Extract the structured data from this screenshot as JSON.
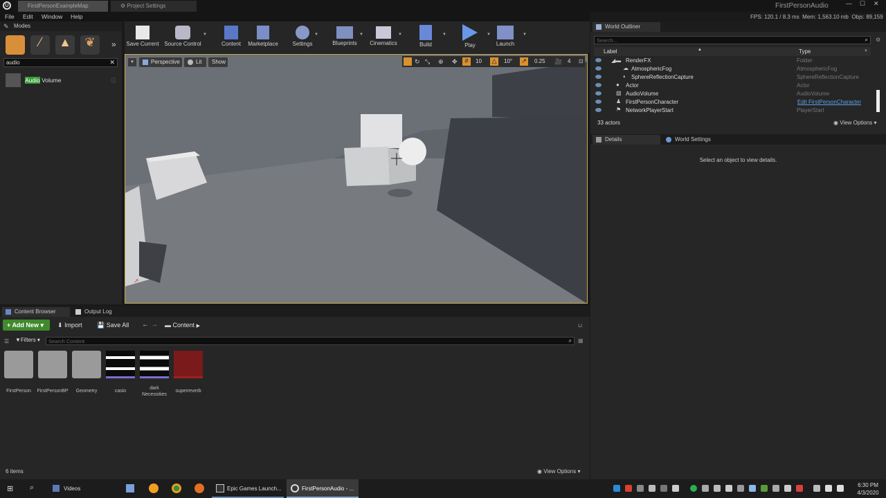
{
  "window": {
    "tabs": [
      "FirstPersonExampleMap",
      "Project Settings"
    ],
    "project_name": "FirstPersonAudio",
    "stats": {
      "fps": "FPS: 120.1",
      "ms": "/ 8.3 ms",
      "mem": "Mem: 1,563.10 mb",
      "objs": "Objs: 89,159"
    }
  },
  "menu": [
    "File",
    "Edit",
    "Window",
    "Help"
  ],
  "modes": {
    "title": "Modes",
    "search_value": "audio",
    "result_highlight": "Audio",
    "result_rest": " Volume"
  },
  "toolbar": [
    {
      "label": "Save Current",
      "icon": "save-icon"
    },
    {
      "label": "Source Control",
      "icon": "source-control-icon"
    },
    {
      "label": "Content",
      "icon": "content-icon"
    },
    {
      "label": "Marketplace",
      "icon": "marketplace-icon"
    },
    {
      "label": "Settings",
      "icon": "settings-icon"
    },
    {
      "label": "Blueprints",
      "icon": "blueprints-icon"
    },
    {
      "label": "Cinematics",
      "icon": "cinematics-icon"
    },
    {
      "label": "Build",
      "icon": "build-icon"
    },
    {
      "label": "Play",
      "icon": "play-icon"
    },
    {
      "label": "Launch",
      "icon": "launch-icon"
    }
  ],
  "viewport": {
    "perspective": "Perspective",
    "lit": "Lit",
    "show": "Show",
    "grid_snap": "10",
    "rot_snap": "10°",
    "scale_snap": "0.25",
    "cam_speed": "4"
  },
  "content_browser": {
    "tabs": [
      "Content Browser",
      "Output Log"
    ],
    "add_new": "Add New",
    "import": "Import",
    "save_all": "Save All",
    "path": "Content",
    "filters": "Filters",
    "search_placeholder": "Search Content",
    "assets": [
      "FirstPerson",
      "FirstPersonBP",
      "Geometry",
      "casio",
      "dark Necessities",
      "superreverb"
    ],
    "item_count": "6 items",
    "view_options": "View Options"
  },
  "outliner": {
    "title": "World Outliner",
    "search_placeholder": "Search...",
    "col_label": "Label",
    "col_type": "Type",
    "rows": [
      {
        "label": "RenderFX",
        "type": "Folder"
      },
      {
        "label": "AtmosphericFog",
        "type": "AtmosphericFog"
      },
      {
        "label": "SphereReflectionCapture",
        "type": "SphereReflectionCapture"
      },
      {
        "label": "Actor",
        "type": "Actor"
      },
      {
        "label": "AudioVolume",
        "type": "AudioVolume"
      },
      {
        "label": "FirstPersonCharacter",
        "type": "Edit FirstPersonCharacter"
      },
      {
        "label": "NetworkPlayerStart",
        "type": "PlayerStart"
      }
    ],
    "actor_count": "33 actors",
    "view_options": "View Options"
  },
  "details": {
    "tabs": [
      "Details",
      "World Settings"
    ],
    "empty_message": "Select an object to view details."
  },
  "taskbar": {
    "items": [
      "Videos",
      "Epic Games Launch...",
      "FirstPersonAudio - ..."
    ],
    "time": "6:30 PM",
    "date": "4/3/2020"
  },
  "colors": {
    "accent": "#c9a84a",
    "add_new": "#3f8a2c",
    "link": "#5aa0e6"
  }
}
